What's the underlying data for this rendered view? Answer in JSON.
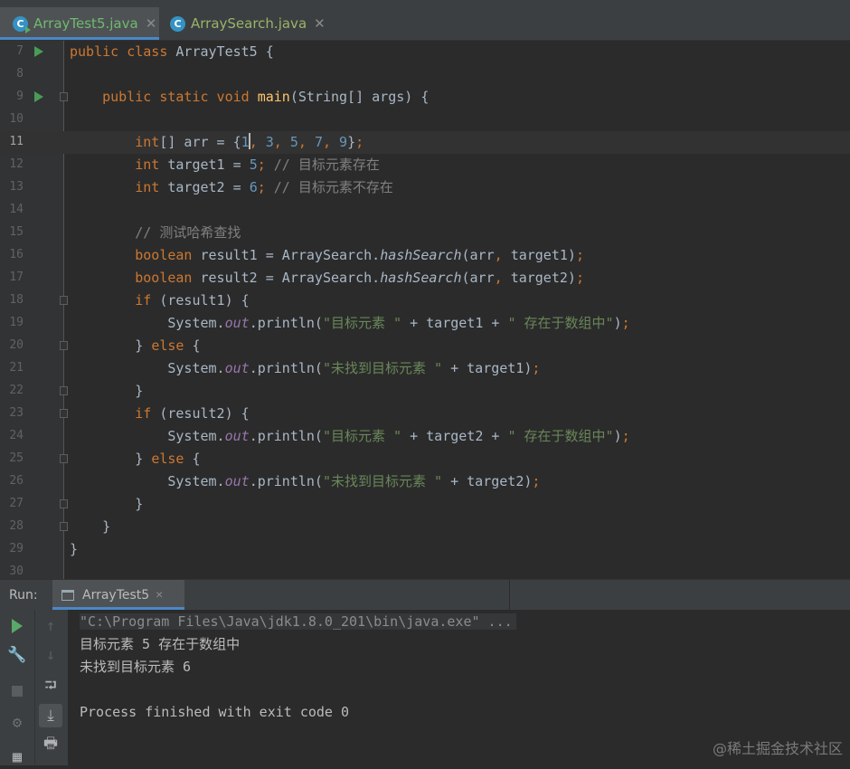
{
  "tabs": [
    {
      "label": "ArrayTest5.java",
      "close": "✕",
      "active": true
    },
    {
      "label": "ArraySearch.java",
      "close": "✕",
      "active": false
    }
  ],
  "editor": {
    "line_numbers": [
      "7",
      "8",
      "9",
      "10",
      "11",
      "12",
      "13",
      "14",
      "15",
      "16",
      "17",
      "18",
      "19",
      "20",
      "21",
      "22",
      "23",
      "24",
      "25",
      "26",
      "27",
      "28",
      "29",
      "30"
    ],
    "current_line": "11"
  },
  "run_panel": {
    "label": "Run:",
    "tab_label": "ArrayTest5",
    "tab_close": "✕",
    "console_lines": [
      "\"C:\\Program Files\\Java\\jdk1.8.0_201\\bin\\java.exe\" ...",
      "目标元素 5 存在于数组中",
      "未找到目标元素 6",
      "",
      "Process finished with exit code 0"
    ]
  },
  "watermark": "@稀土掘金技术社区",
  "colors": {
    "keyword": "#cc7832",
    "number": "#6897bb",
    "string": "#6a8759",
    "comment": "#808080",
    "method": "#ffc66d",
    "field": "#9876aa",
    "text": "#a9b7c6",
    "run_green": "#59a869"
  }
}
